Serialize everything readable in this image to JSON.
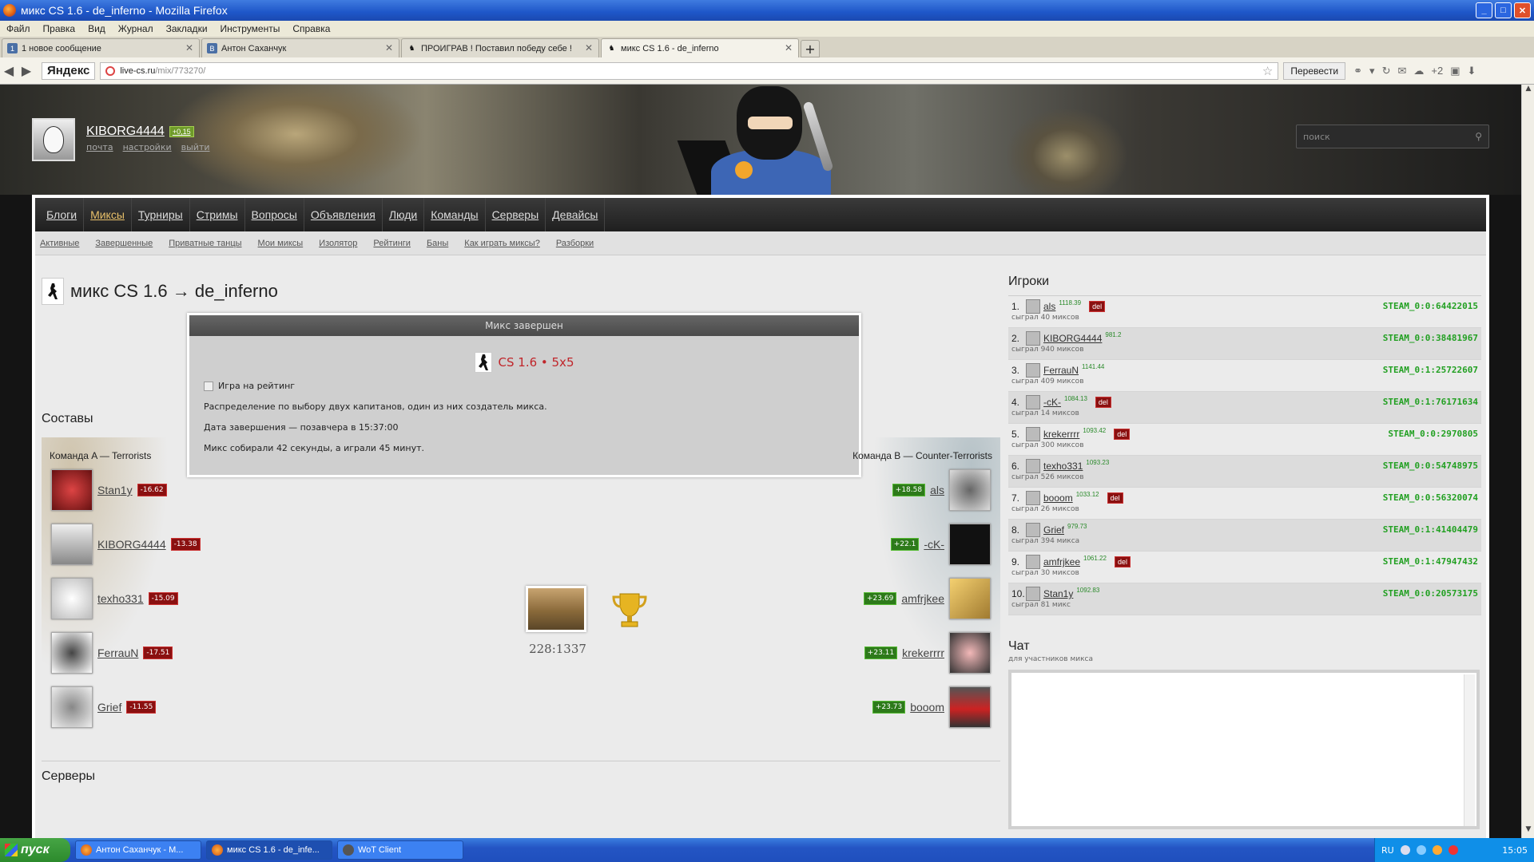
{
  "window": {
    "title": "микс CS 1.6 - de_inferno - Mozilla Firefox"
  },
  "menu": [
    "Файл",
    "Правка",
    "Вид",
    "Журнал",
    "Закладки",
    "Инструменты",
    "Справка"
  ],
  "tabs": [
    {
      "label": "1 новое сообщение",
      "icon": "vk-icon"
    },
    {
      "label": "Антон Саханчук",
      "icon": "vk-icon"
    },
    {
      "label": "ПРОИГРАВ ! Поставил победу себе !",
      "icon": "ct-icon"
    },
    {
      "label": "микс CS 1.6 - de_inferno",
      "icon": "ct-icon"
    }
  ],
  "nav": {
    "yandex": "Яндекс",
    "url_host": "live-cs.ru",
    "url_path": "/mix/773270/",
    "translate": "Перевести",
    "extra": "+2"
  },
  "user": {
    "name": "KIBORG4444",
    "rating": "+0,15",
    "links": [
      "почта",
      "настройки",
      "выйти"
    ]
  },
  "search": {
    "placeholder": "поиск"
  },
  "topnav": [
    "Блоги",
    "Миксы",
    "Турниры",
    "Стримы",
    "Вопросы",
    "Объявления",
    "Люди",
    "Команды",
    "Серверы",
    "Девайсы"
  ],
  "subnav": [
    "Активные",
    "Завершенные",
    "Приватные танцы",
    "Мои миксы",
    "Изолятор",
    "Рейтинги",
    "Баны",
    "Как играть миксы?",
    "Разборки"
  ],
  "page_title": "микс CS 1.6 → de_inferno",
  "mix": {
    "header": "Микс завершен",
    "game": "CS 1.6 • 5x5",
    "rated": "Игра на рейтинг",
    "line1": "Распределение по выбору двух капитанов, один из них создатель микса.",
    "line2": "Дата завершения — позавчера в 15:37:00",
    "line3": "Микс собирали 42 секунды, а играли 45 минут."
  },
  "sostavy": "Составы",
  "teamA": {
    "title": "Команда A — Terrorists",
    "players": [
      {
        "name": "Stan1y",
        "delta": "-16.62"
      },
      {
        "name": "KIBORG4444",
        "delta": "-13.38"
      },
      {
        "name": "texho331",
        "delta": "-15.09"
      },
      {
        "name": "FerrauN",
        "delta": "-17.51"
      },
      {
        "name": "Grief",
        "delta": "-11.55"
      }
    ]
  },
  "teamB": {
    "title": "Команда B — Counter-Terrorists",
    "players": [
      {
        "name": "als",
        "delta": "+18.58"
      },
      {
        "name": "-cK-",
        "delta": "+22.1"
      },
      {
        "name": "amfrjkee",
        "delta": "+23.69"
      },
      {
        "name": "krekerrrr",
        "delta": "+23.11"
      },
      {
        "name": "booom",
        "delta": "+23.73"
      }
    ]
  },
  "score": "228:1337",
  "players_title": "Игроки",
  "players": [
    {
      "n": "1.",
      "name": "als",
      "rating": "1118.39",
      "played": "сыграл 40 миксов",
      "steam": "STEAM_0:0:64422015",
      "del": "del"
    },
    {
      "n": "2.",
      "name": "KIBORG4444",
      "rating": "981.2",
      "played": "сыграл 940 миксов",
      "steam": "STEAM_0:0:38481967",
      "del": ""
    },
    {
      "n": "3.",
      "name": "FerrauN",
      "rating": "1141.44",
      "played": "сыграл 409 миксов",
      "steam": "STEAM_0:1:25722607",
      "del": ""
    },
    {
      "n": "4.",
      "name": "-cK-",
      "rating": "1084.13",
      "played": "сыграл 14 миксов",
      "steam": "STEAM_0:1:76171634",
      "del": "del"
    },
    {
      "n": "5.",
      "name": "krekerrrr",
      "rating": "1093.42",
      "played": "сыграл 300 миксов",
      "steam": "STEAM_0:0:2970805",
      "del": "del"
    },
    {
      "n": "6.",
      "name": "texho331",
      "rating": "1093.23",
      "played": "сыграл 526 миксов",
      "steam": "STEAM_0:0:54748975",
      "del": ""
    },
    {
      "n": "7.",
      "name": "booom",
      "rating": "1033.12",
      "played": "сыграл 26 миксов",
      "steam": "STEAM_0:0:56320074",
      "del": "del"
    },
    {
      "n": "8.",
      "name": "Grief",
      "rating": "979.73",
      "played": "сыграл 394 микса",
      "steam": "STEAM_0:1:41404479",
      "del": ""
    },
    {
      "n": "9.",
      "name": "amfrjkee",
      "rating": "1061.22",
      "played": "сыграл 30 миксов",
      "steam": "STEAM_0:1:47947432",
      "del": "del"
    },
    {
      "n": "10.",
      "name": "Stan1y",
      "rating": "1092.83",
      "played": "сыграл 81 микс",
      "steam": "STEAM_0:0:20573175",
      "del": ""
    }
  ],
  "chat": {
    "title": "Чат",
    "sub": "для участников микса"
  },
  "cutoff": "Серверы",
  "taskbar": {
    "start": "пуск",
    "tasks": [
      "Антон Саханчук - М...",
      "микс CS 1.6 - de_infe...",
      "WoT Client"
    ],
    "lang": "RU",
    "clock": "15:05"
  }
}
